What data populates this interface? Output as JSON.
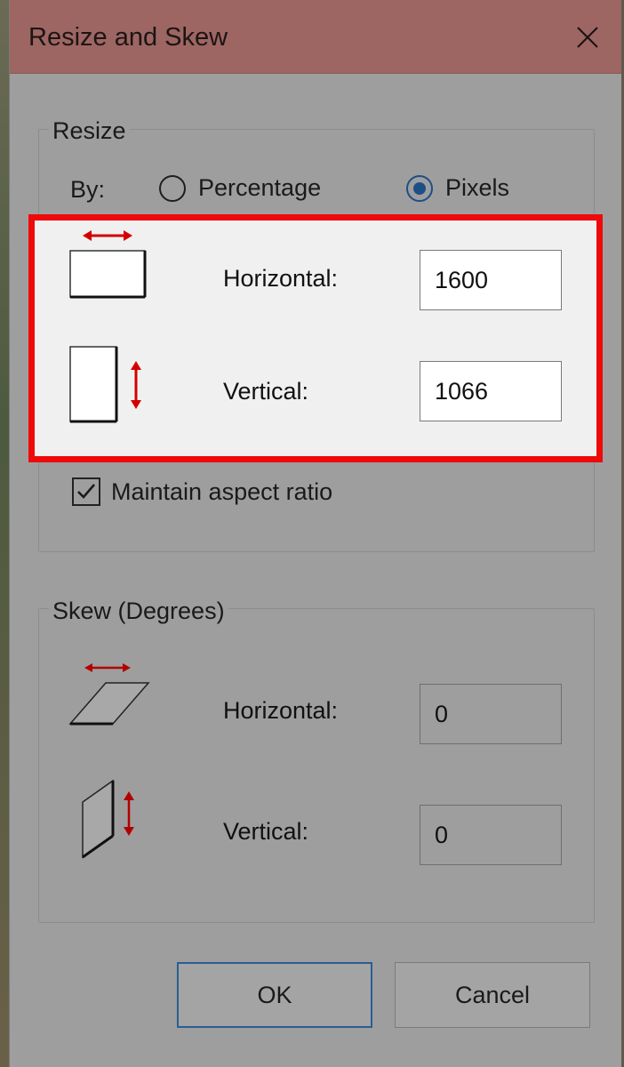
{
  "dialog": {
    "title": "Resize and Skew"
  },
  "resize": {
    "label": "Resize",
    "by_label": "By:",
    "options": [
      {
        "label": "Percentage",
        "selected": false
      },
      {
        "label": "Pixels",
        "selected": true
      }
    ],
    "horizontal_label": "Horizontal:",
    "horizontal_value": "1600",
    "vertical_label": "Vertical:",
    "vertical_value": "1066",
    "maintain_aspect_label": "Maintain aspect ratio",
    "maintain_aspect_checked": true
  },
  "skew": {
    "label": "Skew (Degrees)",
    "horizontal_label": "Horizontal:",
    "horizontal_value": "0",
    "vertical_label": "Vertical:",
    "vertical_value": "0"
  },
  "buttons": {
    "ok_label": "OK",
    "cancel_label": "Cancel"
  },
  "colors": {
    "highlight_border": "#ee0a0a",
    "titlebar": "#9d6663",
    "accent": "#1c4f86",
    "arrow": "#d40000"
  }
}
